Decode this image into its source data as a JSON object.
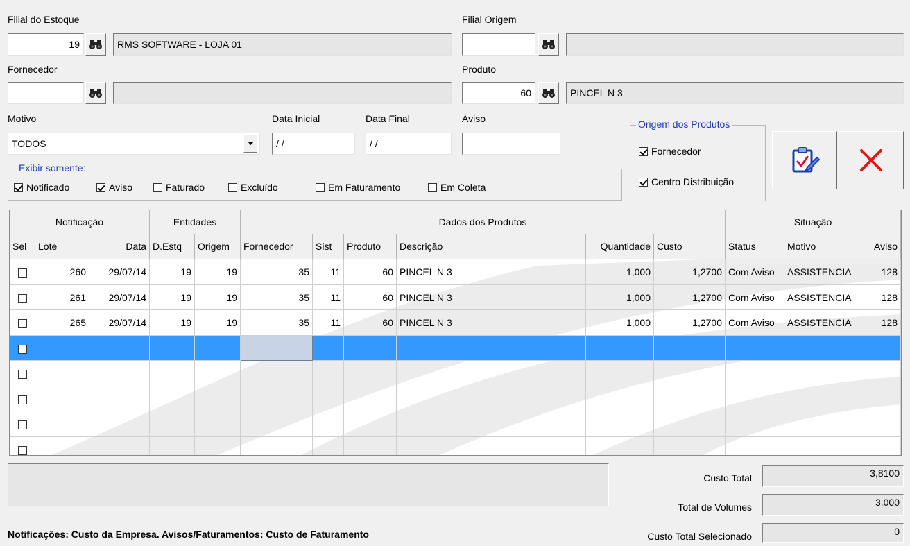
{
  "filial_estoque": {
    "label": "Filial do Estoque",
    "code": "19",
    "name": "RMS SOFTWARE - LOJA 01"
  },
  "filial_origem": {
    "label": "Filial Origem",
    "code": "",
    "name": ""
  },
  "fornecedor": {
    "label": "Fornecedor",
    "code": "",
    "name": ""
  },
  "produto": {
    "label": "Produto",
    "code": "60",
    "name": "PINCEL N 3"
  },
  "motivo": {
    "label": "Motivo",
    "value": "TODOS"
  },
  "data_inicial": {
    "label": "Data Inicial",
    "value": "/ /"
  },
  "data_final": {
    "label": "Data Final",
    "value": "/ /"
  },
  "aviso": {
    "label": "Aviso",
    "value": ""
  },
  "exibir_somente": {
    "title": "Exibir somente:",
    "options": [
      {
        "label": "Notificado",
        "checked": true
      },
      {
        "label": "Aviso",
        "checked": true
      },
      {
        "label": "Faturado",
        "checked": false
      },
      {
        "label": "Excluído",
        "checked": false
      },
      {
        "label": "Em Faturamento",
        "checked": false
      },
      {
        "label": "Em Coleta",
        "checked": false
      }
    ]
  },
  "origem_produtos": {
    "title": "Origem dos  Produtos",
    "options": [
      {
        "label": "Fornecedor",
        "checked": true
      },
      {
        "label": "Centro Distribuição",
        "checked": true
      }
    ]
  },
  "buttons": {
    "confirm_icon": "clipboard-check-icon",
    "cancel_icon": "red-x-icon"
  },
  "grid": {
    "groups": [
      "Notificação",
      "Entidades",
      "Dados dos Produtos",
      "Situação"
    ],
    "columns": [
      "Sel",
      "Lote",
      "Data",
      "D.Estq",
      "Origem",
      "Fornecedor",
      "Sist",
      "Produto",
      "Descrição",
      "Quantidade",
      "Custo",
      "Status",
      "Motivo",
      "Aviso"
    ],
    "rows": [
      {
        "sel": false,
        "lote": "260",
        "data": "29/07/14",
        "destq": "19",
        "origem": "19",
        "fornecedor": "35",
        "sist": "11",
        "produto": "60",
        "descricao": "PINCEL N 3",
        "quantidade": "1,000",
        "custo": "1,2700",
        "status": "Com Aviso",
        "motivo": "ASSISTENCIA",
        "aviso": "128"
      },
      {
        "sel": false,
        "lote": "261",
        "data": "29/07/14",
        "destq": "19",
        "origem": "19",
        "fornecedor": "35",
        "sist": "11",
        "produto": "60",
        "descricao": "PINCEL N 3",
        "quantidade": "1,000",
        "custo": "1,2700",
        "status": "Com Aviso",
        "motivo": "ASSISTENCIA",
        "aviso": "128"
      },
      {
        "sel": false,
        "lote": "265",
        "data": "29/07/14",
        "destq": "19",
        "origem": "19",
        "fornecedor": "35",
        "sist": "11",
        "produto": "60",
        "descricao": "PINCEL N 3",
        "quantidade": "1,000",
        "custo": "1,2700",
        "status": "Com Aviso",
        "motivo": "ASSISTENCIA",
        "aviso": "128"
      }
    ],
    "empty_rows": 5,
    "selected_row": 3
  },
  "footer": {
    "note": "Notificações: Custo da Empresa. Avisos/Faturamentos: Custo de Faturamento",
    "custo_total_label": "Custo Total",
    "custo_total": "3,8100",
    "total_volumes_label": "Total de Volumes",
    "total_volumes": "3,000",
    "custo_selecionado_label": "Custo Total Selecionado",
    "custo_selecionado": "0"
  },
  "colors": {
    "selection": "#3399ff",
    "group_title": "#1a3bb0",
    "cancel": "#e01818"
  }
}
